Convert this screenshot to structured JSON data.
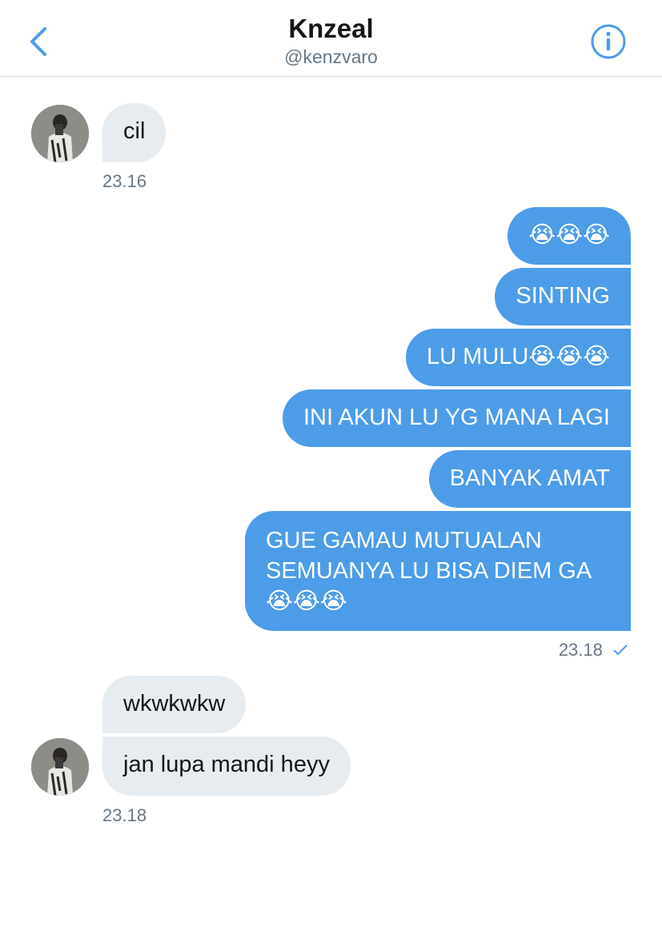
{
  "header": {
    "title": "Knzeal",
    "handle": "@kenzvaro"
  },
  "messages": {
    "in1": {
      "text": "cil",
      "time": "23.16"
    },
    "out": [
      {
        "text": "😭😭😭"
      },
      {
        "text": "SINTING"
      },
      {
        "text": "LU MULU😭😭😭"
      },
      {
        "text": "INI AKUN LU YG MANA LAGI"
      },
      {
        "text": "BANYAK AMAT"
      },
      {
        "text": "GUE GAMAU MUTUALAN SEMUANYA LU BISA DIEM GA 😭😭😭"
      }
    ],
    "out_time": "23.18",
    "in2": [
      {
        "text": "wkwkwkw"
      },
      {
        "text": "jan lupa mandi heyy"
      }
    ],
    "in2_time": "23.18"
  },
  "colors": {
    "accent": "#4d9ce8",
    "incoming_bubble": "#e6ecf0",
    "secondary_text": "#657786"
  },
  "icons": {
    "back": "chevron-left-icon",
    "info": "info-icon",
    "read": "checkmark-icon"
  }
}
